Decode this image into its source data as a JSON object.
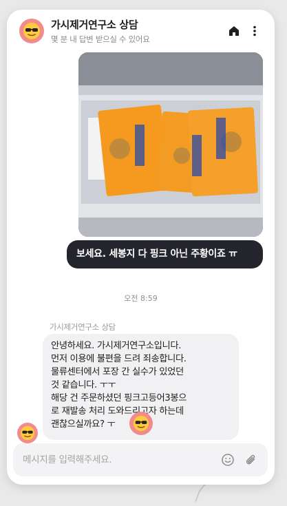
{
  "header": {
    "title": "가시제거연구소 상담",
    "subtitle": "몇 분 내 답변 받으실 수 있어요",
    "avatar_icon": "sunglasses-emoji-icon",
    "home_icon": "home-icon",
    "menu_icon": "more-vertical-icon"
  },
  "messages": {
    "photo": {
      "icon": "photo-attachment"
    },
    "user_text": "보세요. 세봉지 다 핑크 아닌 주황이죠 ㅠ",
    "timestamp": "오전 8:59",
    "agent_name": "가시제거연구소 상담",
    "agent_lines": [
      "안녕하세요. 가시제거연구소입니다.",
      "먼저 이용에 불편을 드려 죄송합니다.",
      "물류센터에서 포장 간 실수가 있었던",
      "것 같습니다. ㅜㅜ",
      "해당 건 주문하셨던 핑크고등어3봉으",
      "로 재발송 처리 도와드리고자 하는데",
      "괜찮으실까요? ㅜ"
    ]
  },
  "composer": {
    "placeholder": "메시지를 입력해주세요.",
    "emoji_icon": "emoji-icon",
    "attach_icon": "paperclip-icon"
  },
  "colors": {
    "accent_avatar": "#f28b8b",
    "user_bubble": "#24252c",
    "agent_bubble": "#f1f1f3",
    "background": "#e9e9e9"
  }
}
